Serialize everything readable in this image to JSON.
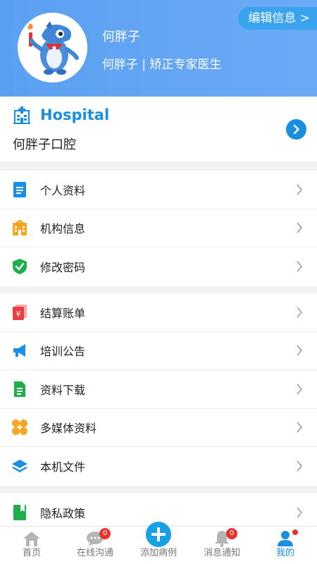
{
  "header": {
    "edit_label": "编辑信息 >",
    "username": "何胖子",
    "subtitle": "何胖子 | 矫正专家医生"
  },
  "hospital": {
    "title": "Hospital",
    "name": "何胖子口腔"
  },
  "groups": [
    {
      "items": [
        {
          "label": "个人资料",
          "icon": "document-icon"
        },
        {
          "label": "机构信息",
          "icon": "building-icon"
        },
        {
          "label": "修改密码",
          "icon": "shield-check-icon"
        }
      ]
    },
    {
      "items": [
        {
          "label": "结算账单",
          "icon": "bill-icon"
        },
        {
          "label": "培训公告",
          "icon": "megaphone-icon"
        },
        {
          "label": "资料下载",
          "icon": "download-doc-icon"
        },
        {
          "label": "多媒体资料",
          "icon": "multimedia-icon"
        },
        {
          "label": "本机文件",
          "icon": "layers-icon"
        }
      ]
    },
    {
      "items": [
        {
          "label": "隐私政策",
          "icon": "bookmark-icon"
        }
      ]
    }
  ],
  "tabs": [
    {
      "label": "首页",
      "icon": "home-icon",
      "badge": ""
    },
    {
      "label": "在线沟通",
      "icon": "chat-icon",
      "badge": "0"
    },
    {
      "label": "添加病例",
      "icon": "add-icon",
      "badge": ""
    },
    {
      "label": "消息通知",
      "icon": "bell-icon",
      "badge": "0"
    },
    {
      "label": "我的",
      "icon": "user-icon",
      "badge": ""
    }
  ],
  "colors": {
    "primary": "#1a8fe0",
    "header": "#5aa0f2",
    "badge": "#e8332c"
  }
}
